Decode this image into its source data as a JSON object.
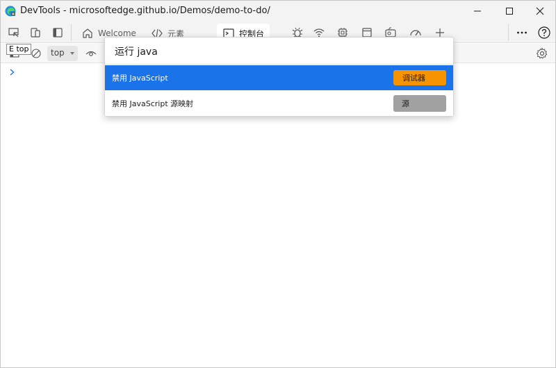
{
  "window": {
    "title": "DevTools - microsoftedge.github.io/Demos/demo-to-do/"
  },
  "tabs": [
    {
      "label": "Welcome"
    },
    {
      "label": "元素"
    },
    {
      "label": "控制台"
    }
  ],
  "console": {
    "context_value": "top",
    "tooltip_text": "E top"
  },
  "command_menu": {
    "query": "运行 java",
    "items": [
      {
        "label": "禁用 JavaScript",
        "badge": "调试器",
        "badge_color": "#f59300",
        "selected": true
      },
      {
        "label": "禁用 JavaScript 源映射",
        "badge": "源",
        "badge_color": "#a1a1a1",
        "selected": false
      }
    ]
  },
  "colors": {
    "accent": "#1a73e8",
    "titlebar": "#f3f3f3"
  }
}
